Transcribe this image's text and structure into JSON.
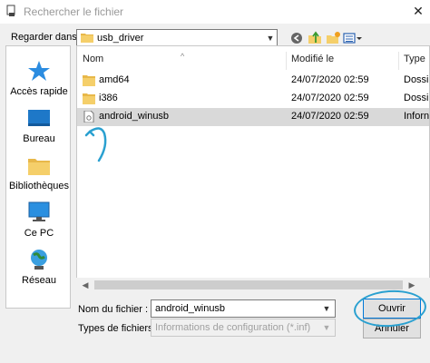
{
  "window": {
    "title": "Rechercher le fichier",
    "close_glyph": "✕"
  },
  "lookin": {
    "label": "Regarder dans :",
    "value": "usb_driver"
  },
  "toolbar": {
    "icons": [
      "back-icon",
      "up-folder-icon",
      "new-folder-icon",
      "view-menu-icon"
    ]
  },
  "places": [
    {
      "label": "Accès rapide",
      "icon": "star-icon"
    },
    {
      "label": "Bureau",
      "icon": "desktop-icon"
    },
    {
      "label": "Bibliothèques",
      "icon": "library-icon"
    },
    {
      "label": "Ce PC",
      "icon": "computer-icon"
    },
    {
      "label": "Réseau",
      "icon": "network-icon"
    }
  ],
  "filelist": {
    "columns": [
      "Nom",
      "Modifié le",
      "Type"
    ],
    "rows": [
      {
        "name": "amd64",
        "modified": "24/07/2020 02:59",
        "type": "Dossi",
        "icon": "folder-icon",
        "selected": false
      },
      {
        "name": "i386",
        "modified": "24/07/2020 02:59",
        "type": "Dossi",
        "icon": "folder-icon",
        "selected": false
      },
      {
        "name": "android_winusb",
        "modified": "24/07/2020 02:59",
        "type": "Inforn",
        "icon": "config-file-icon",
        "selected": true
      }
    ]
  },
  "filename": {
    "label": "Nom du fichier :",
    "value": "android_winusb"
  },
  "filetype": {
    "label": "Types de fichiers :",
    "value": "Informations de configuration (*.inf)"
  },
  "buttons": {
    "open": "Ouvrir",
    "cancel": "Annuler"
  },
  "colors": {
    "accent": "#0078d7",
    "annotation": "#2aa0d0",
    "selection": "#d9d9d9"
  }
}
